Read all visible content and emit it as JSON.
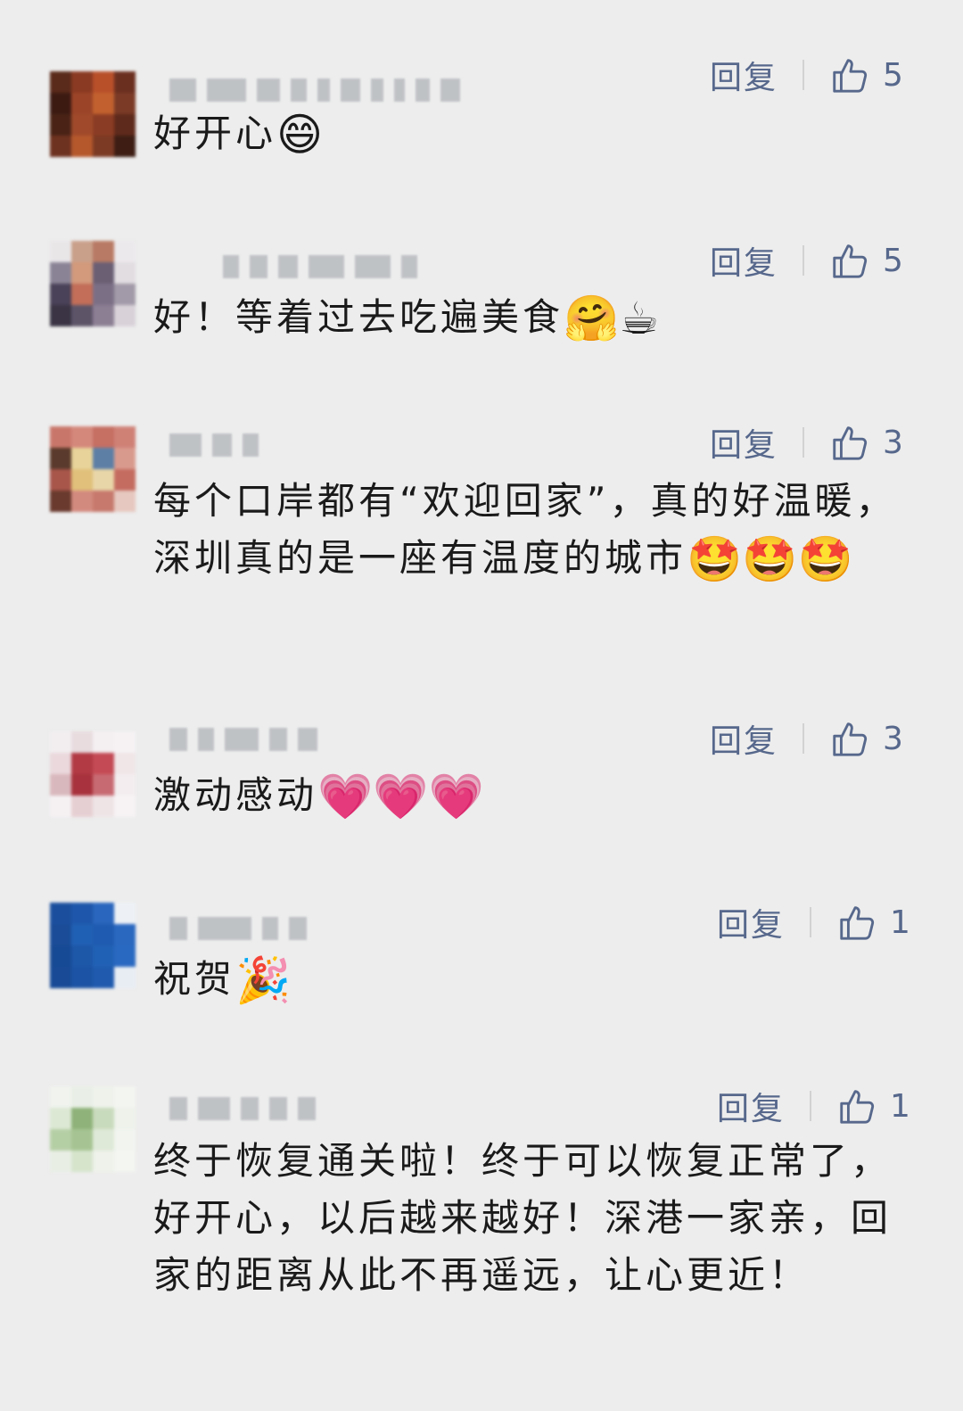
{
  "actions": {
    "reply_label": "回复"
  },
  "comments": [
    {
      "segments": [
        {
          "t": "好开心"
        },
        {
          "emoji": "😄"
        }
      ],
      "likes": "5",
      "avatar_colors": [
        "#5a2a1a",
        "#8a3a22",
        "#b8502a",
        "#6b2f20",
        "#3c1a12",
        "#9c4428",
        "#c2612f",
        "#7a3a26",
        "#4a2316",
        "#a04a2b",
        "#8b3c24",
        "#5e2a1b",
        "#6e3220",
        "#b5582c",
        "#7c3a24",
        "#3d1d14"
      ],
      "name_blocks": [
        30,
        44,
        26,
        18,
        14,
        22,
        14,
        12,
        16,
        22
      ]
    },
    {
      "segments": [
        {
          "t": "好！等着过去吃遍美食"
        },
        {
          "emoji": "🤗"
        },
        {
          "emoji": "☕"
        }
      ],
      "likes": "5",
      "avatar_colors": [
        "#e9e6e8",
        "#c9a08a",
        "#b87a64",
        "#ece9ec",
        "#8a8396",
        "#d39a7c",
        "#6b5f74",
        "#e1dde1",
        "#4a4258",
        "#c26e58",
        "#7b6f86",
        "#a29aa8",
        "#3a3444",
        "#5d5468",
        "#8c7f94",
        "#d8d2d8"
      ],
      "name_blocks": [
        18,
        20,
        22,
        40,
        40,
        18
      ]
    },
    {
      "segments": [
        {
          "t": "每个口岸都有“欢迎回家”，真的好温暖，深圳真的是一座有温度的城市"
        },
        {
          "emoji": "🤩"
        },
        {
          "emoji": "🤩"
        },
        {
          "emoji": "🤩"
        }
      ],
      "likes": "3",
      "avatar_colors": [
        "#c9766a",
        "#d4877b",
        "#c66f63",
        "#cf8176",
        "#5a3a2c",
        "#e8d49a",
        "#5d7fa6",
        "#d99a8e",
        "#a8554a",
        "#e0c07a",
        "#e9d6a8",
        "#c46c60",
        "#6a3a2e",
        "#d38a7e",
        "#c7796d",
        "#e6c8c0"
      ],
      "name_blocks": [
        36,
        22,
        18
      ]
    },
    {
      "segments": [
        {
          "t": "激动感动"
        },
        {
          "emoji": "💗"
        },
        {
          "emoji": "💗"
        },
        {
          "emoji": "💗"
        }
      ],
      "likes": "3",
      "avatar_colors": [
        "#f2eef0",
        "#e8dcdf",
        "#f4eff1",
        "#f6f2f4",
        "#ead8dc",
        "#b23a45",
        "#c44b55",
        "#f0e6e8",
        "#d9b8bd",
        "#a8323d",
        "#c86a72",
        "#f3edef",
        "#f5f1f3",
        "#e6cfd3",
        "#eee4e6",
        "#f7f3f5"
      ],
      "name_blocks": [
        20,
        18,
        38,
        20,
        22
      ]
    },
    {
      "segments": [
        {
          "t": "祝贺"
        },
        {
          "emoji": "🎉"
        }
      ],
      "likes": "1",
      "avatar_colors": [
        "#1b4f9e",
        "#1d56aa",
        "#2a66bd",
        "#edf1f6",
        "#1a4c98",
        "#2060b4",
        "#1f5bb0",
        "#2a68c0",
        "#174a94",
        "#1d57a8",
        "#2161b5",
        "#2a69c1",
        "#184a96",
        "#1c53a4",
        "#1f5aae",
        "#e8edf4"
      ],
      "name_blocks": [
        20,
        60,
        18,
        20
      ]
    },
    {
      "segments": [
        {
          "t": "终于恢复通关啦！终于可以恢复正常了，好开心，以后越来越好！深港一家亲，回家的距离从此不再遥远，让心更近！"
        }
      ],
      "likes": "1",
      "avatar_colors": [
        "#f0f3ee",
        "#e9efe6",
        "#eef2eb",
        "#f3f5f1",
        "#dce8d4",
        "#8fb27a",
        "#c9dbbd",
        "#eef2eb",
        "#b5cfa5",
        "#a6c493",
        "#dfe9d8",
        "#f1f4ef",
        "#e8eee4",
        "#d6e4cc",
        "#eef2ea",
        "#f3f6f1"
      ],
      "name_blocks": [
        20,
        36,
        20,
        20,
        20
      ]
    }
  ]
}
